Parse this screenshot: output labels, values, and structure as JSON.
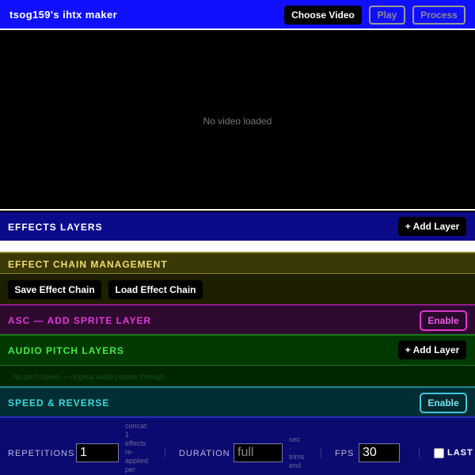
{
  "app": {
    "title": "tsog159's ihtx maker"
  },
  "toolbar": {
    "choose_video": "Choose Video",
    "play": "Play",
    "process": "Process"
  },
  "video": {
    "message": "No video loaded"
  },
  "effects_layers": {
    "title": "EFFECTS LAYERS",
    "add_layer": "+ Add Layer"
  },
  "effect_chain": {
    "title": "EFFECT CHAIN MANAGEMENT",
    "save": "Save Effect Chain",
    "load": "Load Effect Chain"
  },
  "asc": {
    "title": "ASC — ADD SPRITE LAYER",
    "enable": "Enable"
  },
  "audio_pitch": {
    "title": "AUDIO PITCH LAYERS",
    "add_layer": "+ Add Layer",
    "empty_message": "No pitch layers — original audio passes through."
  },
  "speed_reverse": {
    "title": "SPEED & REVERSE",
    "enable": "Enable"
  },
  "controls": {
    "repetitions": {
      "label": "REPETITIONS",
      "value": "1",
      "note": [
        "concat:",
        "1",
        "effects",
        "re-",
        "applied",
        "per"
      ]
    },
    "duration": {
      "label": "DURATION",
      "placeholder": "full",
      "note": [
        "sec",
        "·",
        "trims",
        "end"
      ]
    },
    "fps": {
      "label": "FPS",
      "value": "30"
    },
    "last": {
      "label": "LAST F"
    }
  },
  "colors": {
    "topbar": "#1010ff",
    "effects": "#0a0a8a",
    "chain_accent": "#f3dc75",
    "asc_accent": "#e03ad8",
    "audio_accent": "#46e846",
    "speed_accent": "#3fd8d8"
  }
}
